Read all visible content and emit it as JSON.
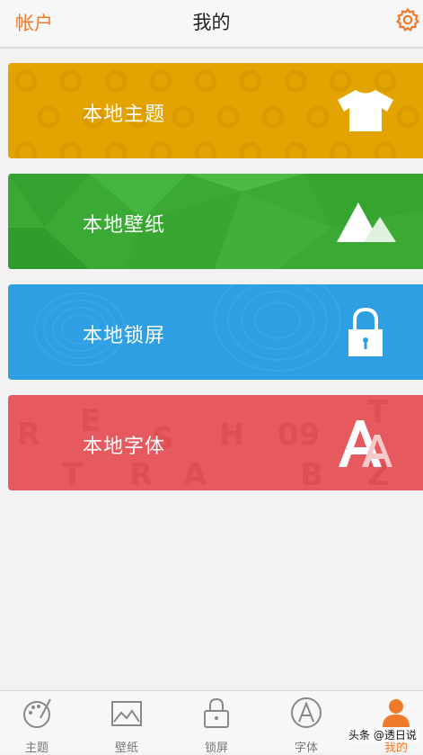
{
  "header": {
    "left_label": "帐户",
    "title": "我的",
    "settings_icon": "gear-icon"
  },
  "cards": [
    {
      "label": "本地主题",
      "icon": "tshirt-icon",
      "color": "#e3a300"
    },
    {
      "label": "本地壁纸",
      "icon": "mountain-icon",
      "color": "#3aaa35"
    },
    {
      "label": "本地锁屏",
      "icon": "lock-icon",
      "color": "#2f9fe3"
    },
    {
      "label": "本地字体",
      "icon": "font-icon",
      "color": "#e65a5f"
    }
  ],
  "tabs": [
    {
      "label": "主题",
      "icon": "palette-icon",
      "active": false
    },
    {
      "label": "壁纸",
      "icon": "image-icon",
      "active": false
    },
    {
      "label": "锁屏",
      "icon": "lock-icon",
      "active": false
    },
    {
      "label": "字体",
      "icon": "font-icon",
      "active": false
    },
    {
      "label": "我的",
      "icon": "person-icon",
      "active": true
    }
  ],
  "accent_color": "#f07a2c",
  "watermark": "头条 @透日说"
}
